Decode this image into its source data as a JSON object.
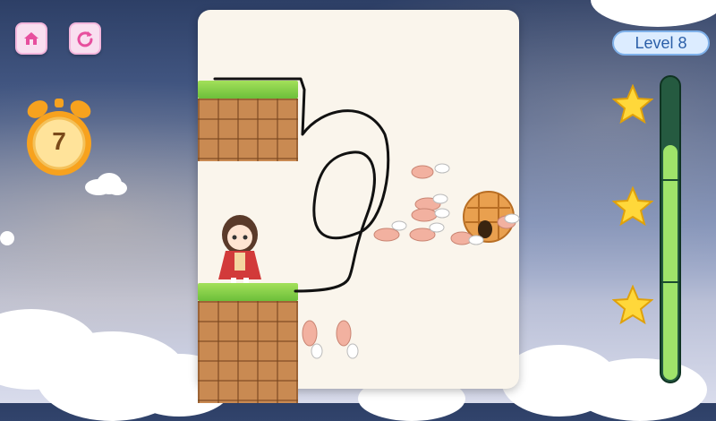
{
  "toolbar": {
    "home_icon": "home-icon",
    "restart_icon": "restart-icon"
  },
  "timer": {
    "value": "7",
    "icon": "alarm-clock-icon"
  },
  "level": {
    "label": "Level 8"
  },
  "progress": {
    "fill_fraction": 0.78,
    "stars": 3
  },
  "colors": {
    "grass": "#7ccc45",
    "brick": "#c98a52",
    "pill_bg": "#dcecff",
    "bar_fill": "#9fe36a",
    "star": "#ffd83a"
  }
}
